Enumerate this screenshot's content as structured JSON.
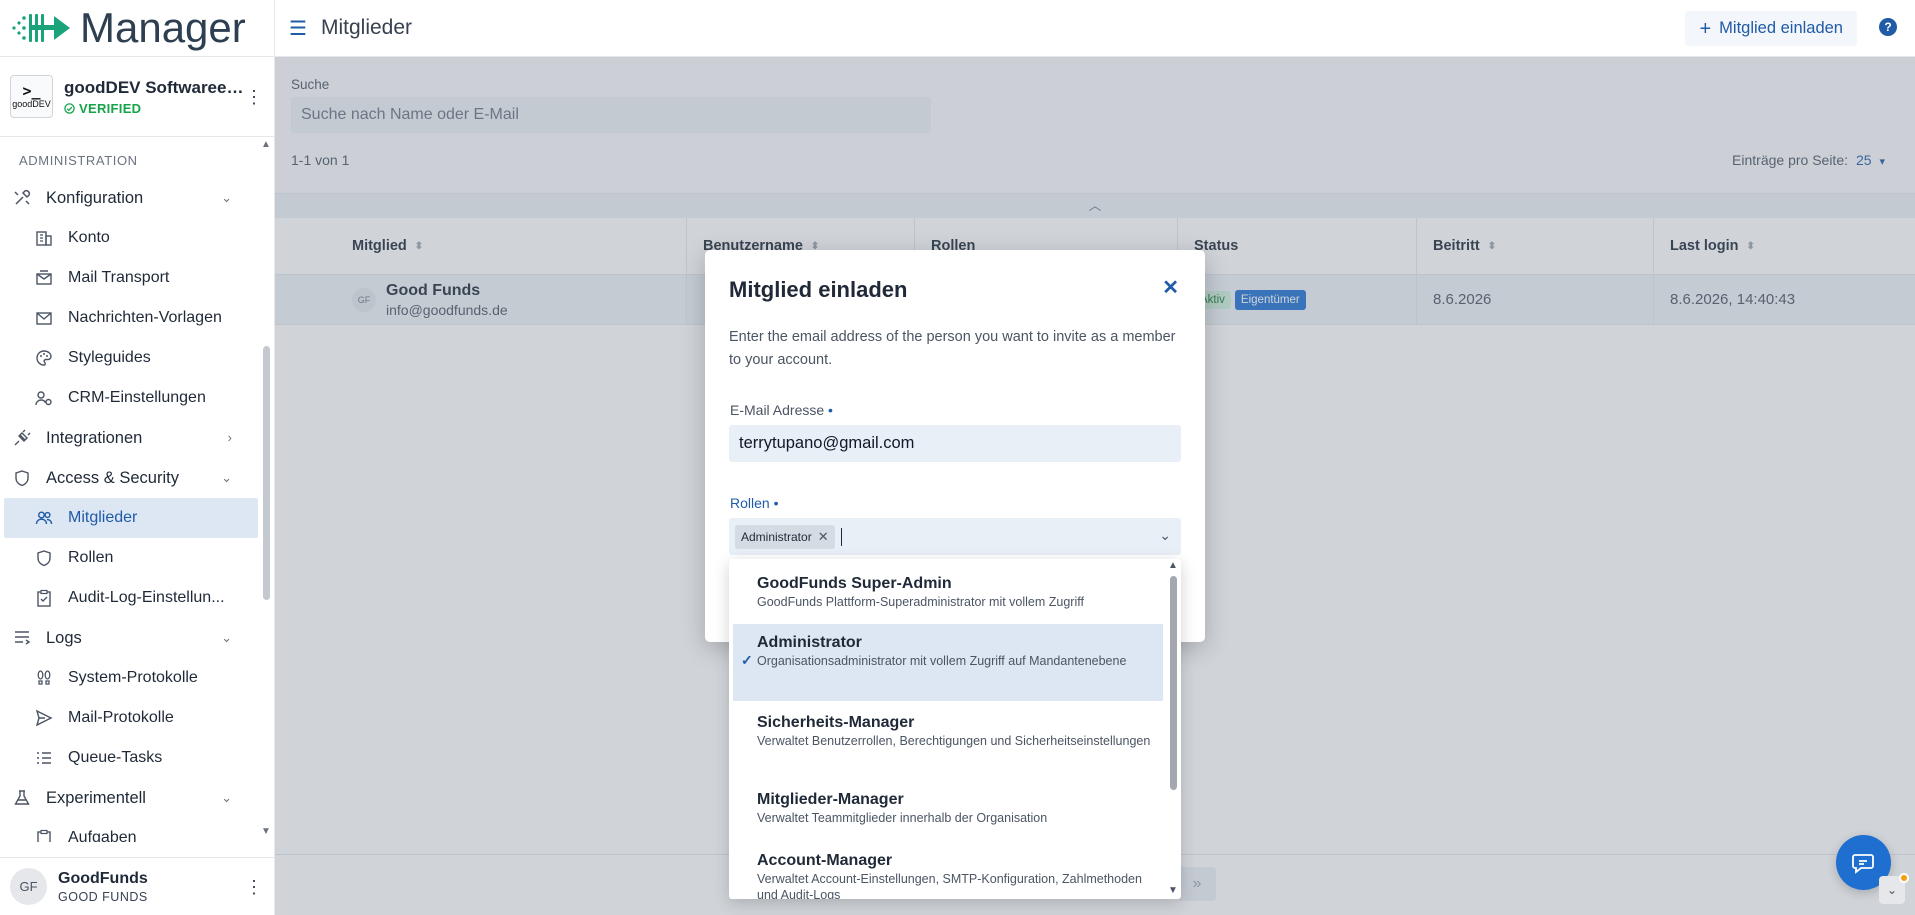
{
  "app": {
    "name": "Manager",
    "org_name": "goodDEV Softwareen...",
    "org_logo_text": "goodDEV",
    "org_status": "VERIFIED"
  },
  "sidebar": {
    "section_label": "ADMINISTRATION",
    "items": [
      {
        "label": "Konfiguration",
        "icon": "tools-icon",
        "level": 0,
        "expand": "down"
      },
      {
        "label": "Konto",
        "icon": "building-icon",
        "level": 1
      },
      {
        "label": "Mail Transport",
        "icon": "mail-transport-icon",
        "level": 1
      },
      {
        "label": "Nachrichten-Vorlagen",
        "icon": "envelope-icon",
        "level": 1
      },
      {
        "label": "Styleguides",
        "icon": "palette-icon",
        "level": 1
      },
      {
        "label": "CRM-Einstellungen",
        "icon": "users-gear-icon",
        "level": 1
      },
      {
        "label": "Integrationen",
        "icon": "plug-icon",
        "level": 0,
        "expand": "right"
      },
      {
        "label": "Access & Security",
        "icon": "shield-icon",
        "level": 0,
        "expand": "down"
      },
      {
        "label": "Mitglieder",
        "icon": "users-icon",
        "level": 1,
        "active": true
      },
      {
        "label": "Rollen",
        "icon": "shield-icon",
        "level": 1
      },
      {
        "label": "Audit-Log-Einstellun...",
        "icon": "clipboard-icon",
        "level": 1
      },
      {
        "label": "Logs",
        "icon": "logs-icon",
        "level": 0,
        "expand": "down"
      },
      {
        "label": "System-Protokolle",
        "icon": "footprints-icon",
        "level": 1
      },
      {
        "label": "Mail-Protokolle",
        "icon": "send-icon",
        "level": 1
      },
      {
        "label": "Queue-Tasks",
        "icon": "list-icon",
        "level": 1
      },
      {
        "label": "Experimentell",
        "icon": "flask-icon",
        "level": 0,
        "expand": "down"
      },
      {
        "label": "Aufgaben",
        "icon": "clipboard-icon",
        "level": 1
      }
    ]
  },
  "user": {
    "initials": "GF",
    "name": "GoodFunds",
    "org": "GOOD FUNDS"
  },
  "header": {
    "title": "Mitglieder",
    "invite_button": "Mitglied einladen",
    "help": "?"
  },
  "filter": {
    "search_label": "Suche",
    "search_placeholder": "Suche nach Name oder E-Mail",
    "count": "1-1 von 1",
    "per_page_label": "Einträge pro Seite:",
    "per_page_value": "25"
  },
  "table": {
    "columns": [
      "Mitglied",
      "Benutzername",
      "Rollen",
      "Status",
      "Beitritt",
      "Last login"
    ],
    "rows": [
      {
        "initials": "GF",
        "name": "Good Funds",
        "email": "info@goodfunds.de",
        "username": "",
        "roles": "",
        "status": "Aktiv",
        "role_badge": "Eigentümer",
        "joined": "8.6.2026",
        "last_login": "8.6.2026, 14:40:43"
      }
    ]
  },
  "modal": {
    "title": "Mitglied einladen",
    "description": "Enter the email address of the person you want to invite as a member to your account.",
    "email_label": "E-Mail Adresse",
    "email_value": "terrytupano@gmail.com",
    "roles_label": "Rollen",
    "required_mark": "•",
    "selected_roles": [
      "Administrator"
    ]
  },
  "dropdown": {
    "options": [
      {
        "title": "GoodFunds Super-Admin",
        "desc": "GoodFunds Plattform-Superadministrator mit vollem Zugriff",
        "selected": false
      },
      {
        "title": "Administrator",
        "desc": "Organisationsadministrator mit vollem Zugriff auf Mandantenebene",
        "selected": true
      },
      {
        "title": "Sicherheits-Manager",
        "desc": "Verwaltet Benutzerrollen, Berechtigungen und Sicherheitseinstellungen",
        "selected": false
      },
      {
        "title": "Mitglieder-Manager",
        "desc": "Verwaltet Teammitglieder innerhalb der Organisation",
        "selected": false
      },
      {
        "title": "Account-Manager",
        "desc": "Verwaltet Account-Einstellungen, SMTP-Konfiguration, Zahlmethoden und Audit-Logs",
        "selected": false
      }
    ]
  },
  "colors": {
    "accent": "#1f5ba7",
    "primary_button": "#1f6fd1",
    "verified": "#16a34a",
    "active_nav_bg": "#dde7f3"
  }
}
